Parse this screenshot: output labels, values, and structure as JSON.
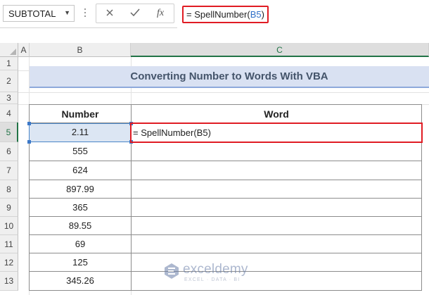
{
  "name_box": {
    "value": "SUBTOTAL"
  },
  "formula_bar": {
    "cancel_icon": "close-icon",
    "enter_icon": "check-icon",
    "fx_label": "fx",
    "formula_prefix": "= SpellNumber(",
    "formula_ref": "B5",
    "formula_suffix": ")"
  },
  "columns": [
    "A",
    "B",
    "C"
  ],
  "rows": [
    "1",
    "2",
    "3",
    "4",
    "5",
    "6",
    "7",
    "8",
    "9",
    "10",
    "11",
    "12",
    "13"
  ],
  "sheet": {
    "title": "Converting Number to Words With VBA",
    "headers": {
      "number": "Number",
      "word": "Word"
    },
    "numbers": [
      "2.11",
      "555",
      "624",
      "897.99",
      "365",
      "89.55",
      "69",
      "125",
      "345.26"
    ],
    "active_cell_text": "= SpellNumber(B5)",
    "active_cell": "C5",
    "selected_cell": "B5"
  },
  "watermark": {
    "name": "exceldemy",
    "tagline": "EXCEL · DATA · BI"
  },
  "colors": {
    "highlight_red": "#e01c24",
    "title_fill": "#d9e1f2",
    "excel_green": "#217346"
  }
}
